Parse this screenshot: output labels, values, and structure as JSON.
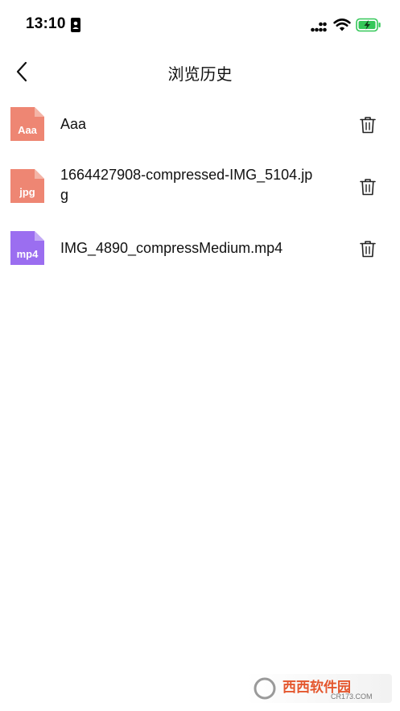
{
  "status_bar": {
    "time": "13:10",
    "icons": [
      "id-badge-icon",
      "cellular-signal-icon",
      "wifi-icon",
      "battery-charging-icon"
    ],
    "battery_color": "#34c759"
  },
  "nav": {
    "title": "浏览历史",
    "back_icon": "chevron-left-icon"
  },
  "files": [
    {
      "name": "Aaa",
      "type_label": "Aaa",
      "icon_color": "#ee8673",
      "icon_fold": "#f4b4a6"
    },
    {
      "name": "1664427908-compressed-IMG_5104.jpg",
      "type_label": "jpg",
      "icon_color": "#ee8673",
      "icon_fold": "#f4b4a6"
    },
    {
      "name": "IMG_4890_compressMedium.mp4",
      "type_label": "mp4",
      "icon_color": "#9b6ef0",
      "icon_fold": "#c3a9f6"
    }
  ],
  "row_action_icon": "trash-icon",
  "watermark": {
    "brand": "西西软件园",
    "domain": "CR173.COM"
  }
}
